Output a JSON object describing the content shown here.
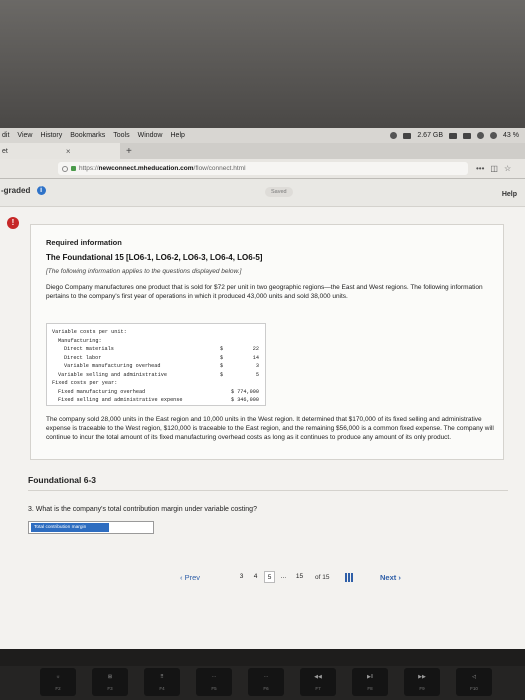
{
  "menubar": {
    "items": [
      "dit",
      "View",
      "History",
      "Bookmarks",
      "Tools",
      "Window",
      "Help"
    ],
    "status": {
      "disk": "2.67 GB",
      "battery": "43 %"
    }
  },
  "browser": {
    "tab_title": "et",
    "tab_close": "×",
    "new_tab": "+",
    "url_prefix": "https://",
    "url_domain": "newconnect.mheducation.com",
    "url_path": "/flow/connect.html",
    "more": "•••"
  },
  "page": {
    "graded_label": "-graded",
    "saved_label": "Saved",
    "help_label": "Help",
    "alert_mark": "!",
    "required_title": "Required information",
    "foundational_title": "The Foundational 15 [LO6-1, LO6-2, LO6-3, LO6-4, LO6-5]",
    "note": "[The following information applies to the questions displayed below.]",
    "paragraph1": "Diego Company manufactures one product that is sold for $72 per unit in two geographic regions—the East and West regions. The following information pertains to the company's first year of operations in which it produced 43,000 units and sold 38,000 units.",
    "cost_table": [
      {
        "label": "Variable costs per unit:",
        "indent": 0,
        "sym": "",
        "value": ""
      },
      {
        "label": "Manufacturing:",
        "indent": 1,
        "sym": "",
        "value": ""
      },
      {
        "label": "Direct materials",
        "indent": 2,
        "sym": "$",
        "value": "22"
      },
      {
        "label": "Direct labor",
        "indent": 2,
        "sym": "$",
        "value": "14"
      },
      {
        "label": "Variable manufacturing overhead",
        "indent": 2,
        "sym": "$",
        "value": "3"
      },
      {
        "label": "Variable selling and administrative",
        "indent": 1,
        "sym": "$",
        "value": "5"
      },
      {
        "label": "Fixed costs per year:",
        "indent": 0,
        "sym": "",
        "value": ""
      },
      {
        "label": "Fixed manufacturing overhead",
        "indent": 1,
        "sym": "",
        "value": "$ 774,000"
      },
      {
        "label": "Fixed selling and administrative expense",
        "indent": 1,
        "sym": "",
        "value": "$ 346,000"
      }
    ],
    "paragraph2": "The company sold 28,000 units in the East region and 10,000 units in the West region. It determined that $170,000 of its fixed selling and administrative expense is traceable to the West region, $120,000 is traceable to the East region, and the remaining $56,000 is a common fixed expense. The company will continue to incur the total amount of its fixed manufacturing overhead costs as long as it continues to produce any amount of its only product.",
    "section_title": "Foundational 6-3",
    "question": "3. What is the company's total contribution margin under variable costing?",
    "answer_label": "Total contribution margin"
  },
  "pager": {
    "prev": "‹  Prev",
    "pages": [
      "3",
      "4",
      "5",
      "...",
      "15"
    ],
    "active_page": "5",
    "of_text": "of 15",
    "next": "Next  ›"
  },
  "keyboard": {
    "keys": [
      {
        "glyph": "☼",
        "label": "F2"
      },
      {
        "glyph": "⊞",
        "label": "F3"
      },
      {
        "glyph": "⠿",
        "label": "F4"
      },
      {
        "glyph": "⋯",
        "label": "F5"
      },
      {
        "glyph": "⋯",
        "label": "F6"
      },
      {
        "glyph": "◀◀",
        "label": "F7"
      },
      {
        "glyph": "▶‖",
        "label": "F8"
      },
      {
        "glyph": "▶▶",
        "label": "F9"
      },
      {
        "glyph": "◁",
        "label": "F10"
      }
    ]
  }
}
